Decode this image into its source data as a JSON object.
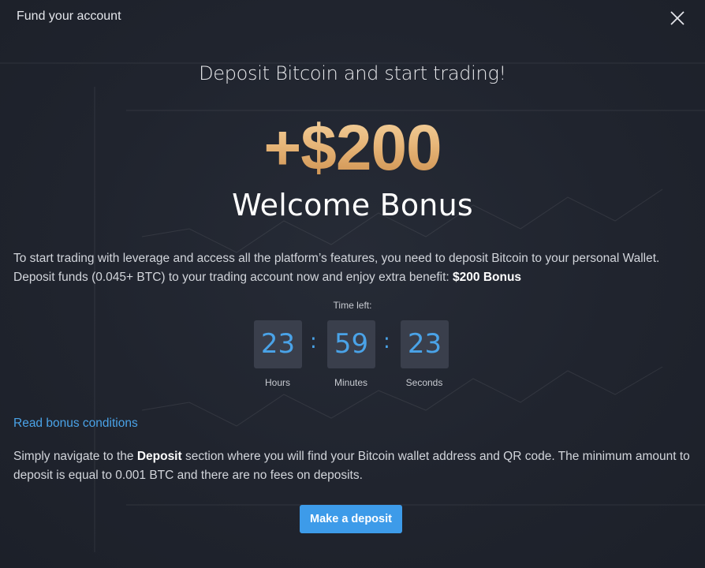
{
  "modal": {
    "title": "Fund your account",
    "headline": "Deposit Bitcoin and start trading!",
    "bonus_amount": "+$200",
    "bonus_label": "Welcome Bonus",
    "description_line1": "To start trading with leverage and access all the platform’s features, you need to deposit Bitcoin to your personal Wallet.",
    "description_line2_prefix": "Deposit funds (0.045+ BTC) to your trading account now and enjoy extra benefit: ",
    "description_line2_bold": "$200 Bonus",
    "time_left_label": "Time left:",
    "timer": {
      "hours": "23",
      "minutes": "59",
      "seconds": "23",
      "hours_label": "Hours",
      "minutes_label": "Minutes",
      "seconds_label": "Seconds",
      "separator": ":"
    },
    "read_conditions_link": "Read bonus conditions",
    "instructions_prefix": "Simply navigate to the ",
    "instructions_bold": "Deposit",
    "instructions_suffix": " section where you will find your Bitcoin wallet address and QR code. The minimum amount to deposit is equal to 0.001 BTC and there are no fees on deposits.",
    "deposit_button": "Make a deposit",
    "close_icon": "close-icon"
  },
  "colors": {
    "accent_blue": "#4aa3e8",
    "button_blue": "#3d9be9",
    "gold_light": "#f6d7a6",
    "gold_dark": "#c98a48",
    "background": "#20242e",
    "timer_box": "#3a3f4c"
  }
}
